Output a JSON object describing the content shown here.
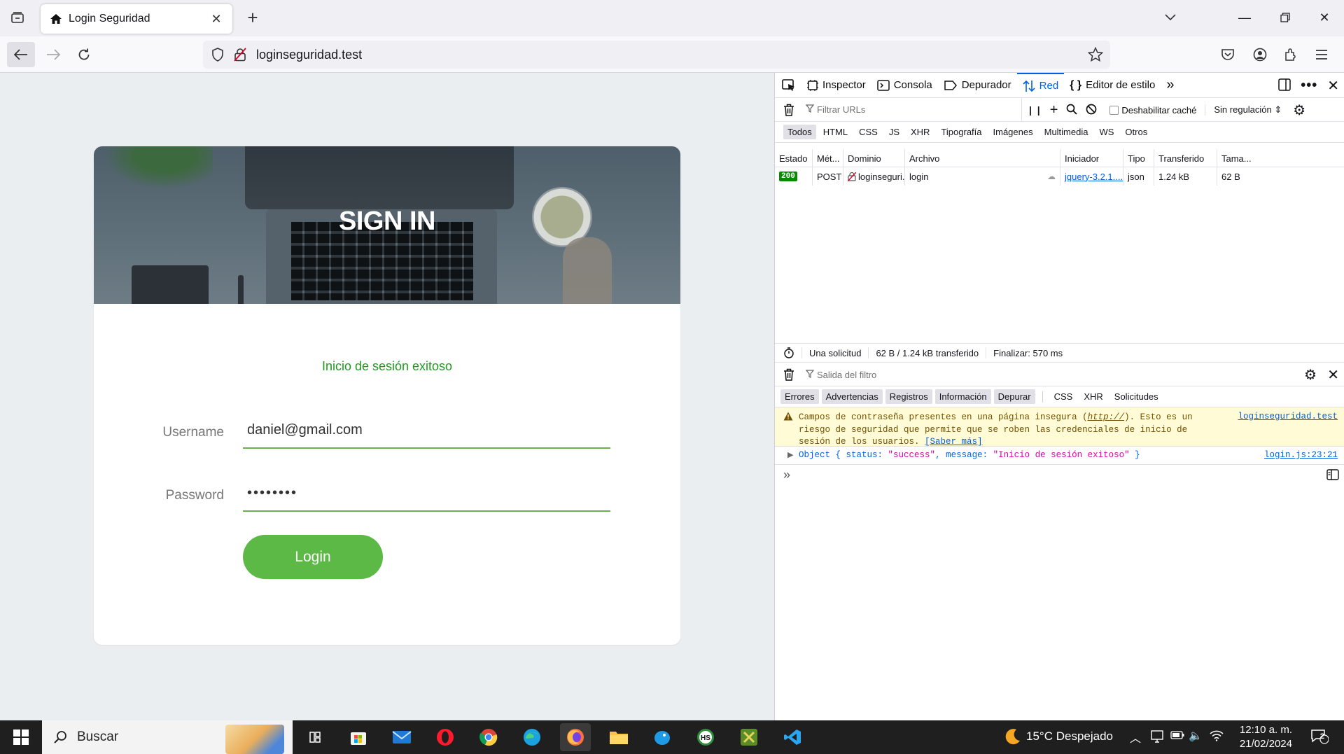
{
  "browser": {
    "tab_title": "Login Seguridad",
    "url": "loginseguridad.test"
  },
  "page": {
    "hero_title": "SIGN IN",
    "success_message": "Inicio de sesión exitoso",
    "username_label": "Username",
    "username_value": "daniel@gmail.com",
    "password_label": "Password",
    "password_value": "••••••••",
    "login_button": "Login"
  },
  "devtools": {
    "tabs": [
      "Inspector",
      "Consola",
      "Depurador",
      "Red",
      "Editor de estilo"
    ],
    "active_tab": "Red",
    "filter_placeholder": "Filtrar URLs",
    "disable_cache": "Deshabilitar caché",
    "throttling": "Sin regulación ⇕",
    "type_filters": [
      "Todos",
      "HTML",
      "CSS",
      "JS",
      "XHR",
      "Tipografía",
      "Imágenes",
      "Multimedia",
      "WS",
      "Otros"
    ],
    "columns": [
      "Estado",
      "Mét...",
      "Dominio",
      "Archivo",
      "Iniciador",
      "Tipo",
      "Transferido",
      "Tama..."
    ],
    "request": {
      "status": "200",
      "method": "POST",
      "domain": "loginseguri...",
      "file": "login",
      "initiator": "jquery-3.2.1....",
      "type": "json",
      "transferred": "1.24 kB",
      "size": "62 B"
    },
    "summary": {
      "requests": "Una solicitud",
      "transferred": "62 B / 1.24 kB transferido",
      "finish": "Finalizar: 570 ms"
    },
    "console": {
      "filter_placeholder": "Salida del filtro",
      "filters": [
        "Errores",
        "Advertencias",
        "Registros",
        "Información",
        "Depurar",
        "CSS",
        "XHR",
        "Solicitudes"
      ],
      "warning_text": "Campos de contraseña presentes en una página insegura (",
      "warning_link": "http://",
      "warning_text2": "). Esto es un riesgo de seguridad que permite que se roben las credenciales de inicio de sesión de los usuarios.",
      "warning_more": "[Saber más]",
      "warning_source": "loginseguridad.test",
      "log_prefix": "Object { ",
      "log_key1": "status",
      "log_val1": "\"success\"",
      "log_key2": "message",
      "log_val2": "\"Inicio de sesión exitoso\"",
      "log_suffix": " }",
      "log_source": "login.js:23:21",
      "prompt": "»"
    }
  },
  "taskbar": {
    "search_label": "Buscar",
    "weather": "15°C  Despejado",
    "time": "12:10 a. m.",
    "date": "21/02/2024",
    "notifications": "2"
  }
}
